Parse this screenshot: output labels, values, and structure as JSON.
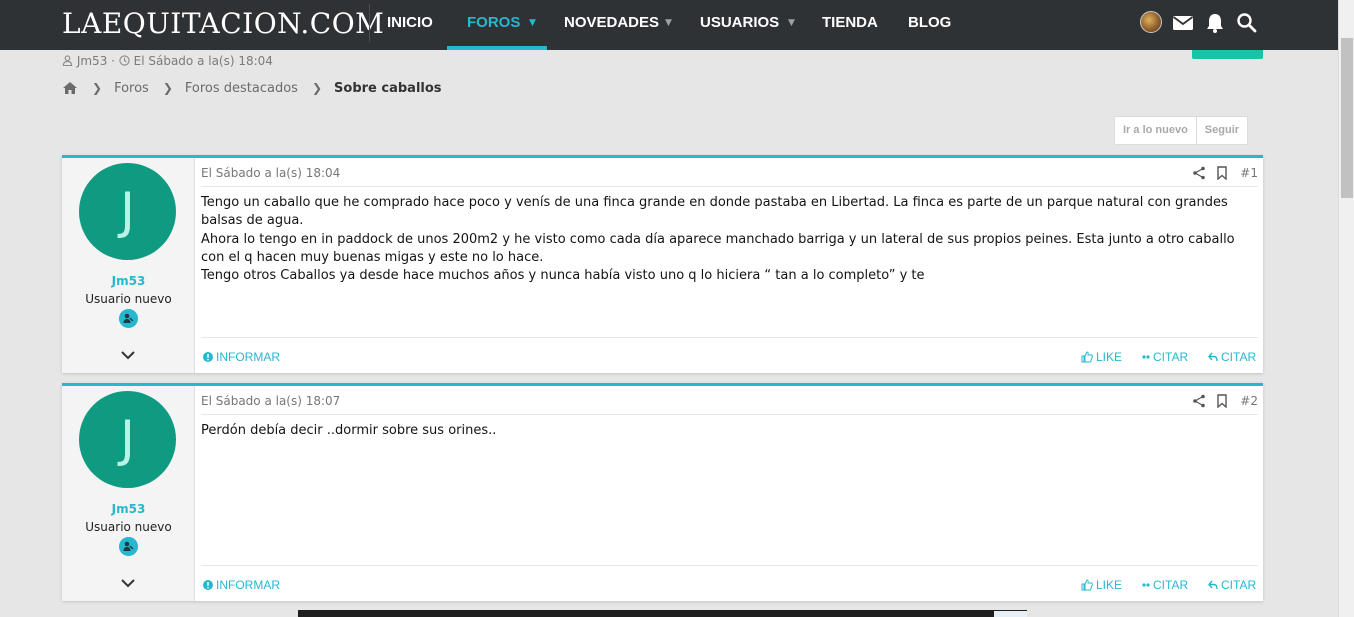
{
  "site": {
    "logo": "LAEQUITACION.COM"
  },
  "nav": {
    "items": [
      {
        "label": "INICIO",
        "active": false,
        "dropdown": false
      },
      {
        "label": "FOROS",
        "active": true,
        "dropdown": true
      },
      {
        "label": "NOVEDADES",
        "active": false,
        "dropdown": true
      },
      {
        "label": "USUARIOS",
        "active": false,
        "dropdown": true
      },
      {
        "label": "TIENDA",
        "active": false,
        "dropdown": false
      },
      {
        "label": "BLOG",
        "active": false,
        "dropdown": false
      }
    ],
    "icons": [
      "user-avatar",
      "mail-icon",
      "bell-icon",
      "search-icon"
    ]
  },
  "thread": {
    "author": "Jm53",
    "date": "El Sábado a la(s) 18:04"
  },
  "breadcrumb": {
    "items": [
      "Foros",
      "Foros destacados"
    ],
    "current": "Sobre caballos"
  },
  "thread_actions": {
    "jump_new": "Ir a lo nuevo",
    "follow": "Seguir"
  },
  "posts": [
    {
      "avatar_letter": "J",
      "username": "Jm53",
      "user_title": "Usuario nuevo",
      "date": "El Sábado a la(s) 18:04",
      "number": "#1",
      "body": [
        "Tengo un caballo que he comprado hace poco y venís de una finca grande en donde pastaba en Libertad. La finca es parte de un parque natural con grandes balsas de agua.",
        "Ahora lo tengo en in paddock de unos 200m2 y he visto como cada día aparece manchado barriga y un lateral de sus propios peines. Esta junto a otro caballo con el q hacen muy buenas migas y este no lo hace.",
        "Tengo otros Caballos ya desde hace muchos años y nunca había visto uno q lo hiciera “ tan a lo completo” y te"
      ],
      "report": "INFORMAR",
      "like": "LIKE",
      "quote": "CITAR",
      "reply": "CITAR"
    },
    {
      "avatar_letter": "J",
      "username": "Jm53",
      "user_title": "Usuario nuevo",
      "date": "El Sábado a la(s) 18:07",
      "number": "#2",
      "body": [
        "Perdón debía decir ..dormir sobre sus orines.."
      ],
      "report": "INFORMAR",
      "like": "LIKE",
      "quote": "CITAR",
      "reply": "CITAR"
    }
  ],
  "colors": {
    "navbar": "#2f3235",
    "accent": "#26b8cf",
    "avatar": "#0f9a82",
    "green_tab": "#18c3a6"
  }
}
